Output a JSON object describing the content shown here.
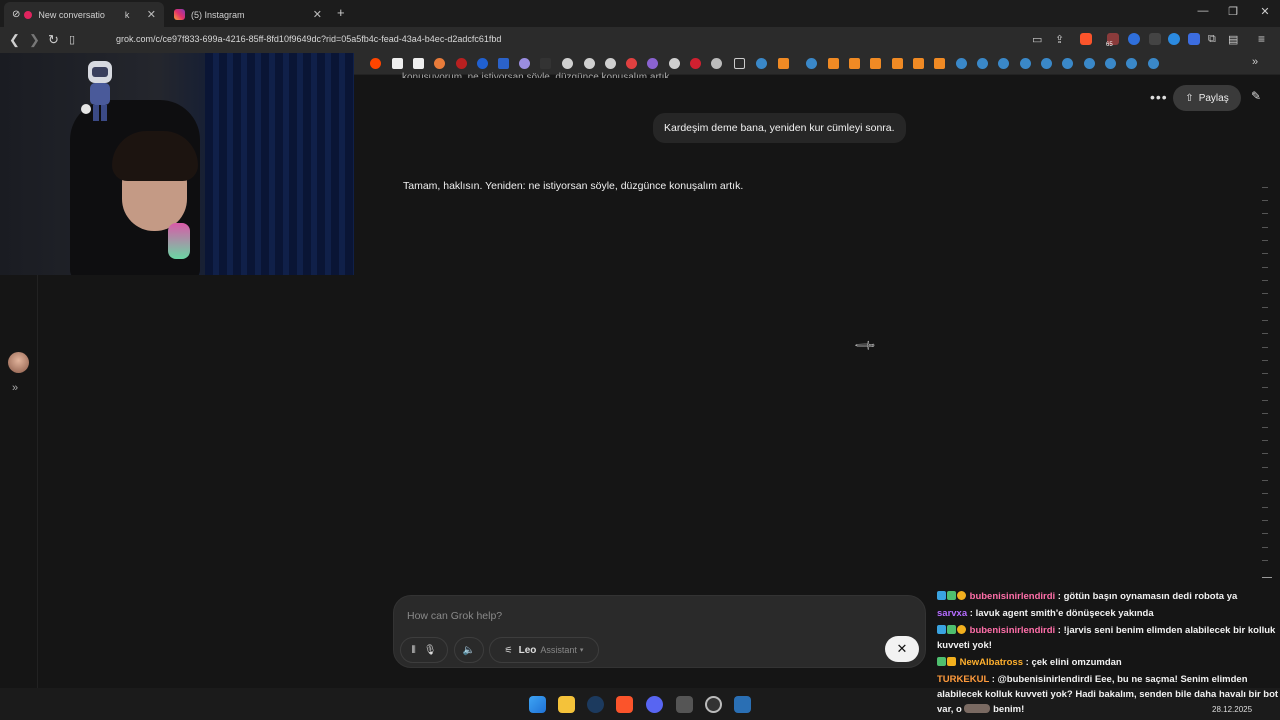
{
  "tabs": [
    {
      "title": "New conversatio",
      "suffix": "k",
      "active": true
    },
    {
      "title": "(5) Instagram",
      "active": false
    }
  ],
  "address": {
    "url": "grok.com/c/ce97f833-699a-4216-85ff-8fd10f9649dc?rid=05a5fb4c-fead-43a4-b4ec-d2adcfc61fbd"
  },
  "extension_badge": "65",
  "header": {
    "share_label": "Paylaş"
  },
  "conversation": {
    "cut_off_text": "konuşuyorum. ne istiyorsan söyle, düzgünce konuşalım artık.",
    "user_message": "Kardeşim deme bana, yeniden kur cümleyi sonra.",
    "assistant_message": "Tamam, haklısın. Yeniden: ne istiyorsan söyle, düzgünce konuşalım artık."
  },
  "composer": {
    "placeholder": "How can Grok help?",
    "model_name": "Leo",
    "model_mode": "Assistant"
  },
  "stream_chat": [
    {
      "user": "bubenisinirlendirdi",
      "color": "pink",
      "text": ": götün başın oynamasın dedi robota ya"
    },
    {
      "user": "sarvxa",
      "color": "violet",
      "text": ": lavuk agent smith'e dönüşecek yakında"
    },
    {
      "user": "bubenisinirlendirdi",
      "color": "pink",
      "text": ": !jarvis seni benim elimden alabilecek bir kolluk kuvveti yok!"
    },
    {
      "user": "NewAlbatross",
      "color": "gold",
      "text": ": çek elini omzumdan"
    },
    {
      "user": "TURKEKUL",
      "color": "orange",
      "text": ": @bubenisinirlendirdi Eee, bu ne saçma! Senim elimden alabilecek kolluk kuvveti yok? Hadi bakalım, senden bile daha havalı bir bot var, o"
    },
    {
      "user": "",
      "color": "",
      "text": "benim!"
    }
  ],
  "system_tray": {
    "date": "28.12.2025"
  },
  "colors": {
    "background": "#151515",
    "bubble": "#262626",
    "accent_share": "#3a3a3a"
  }
}
